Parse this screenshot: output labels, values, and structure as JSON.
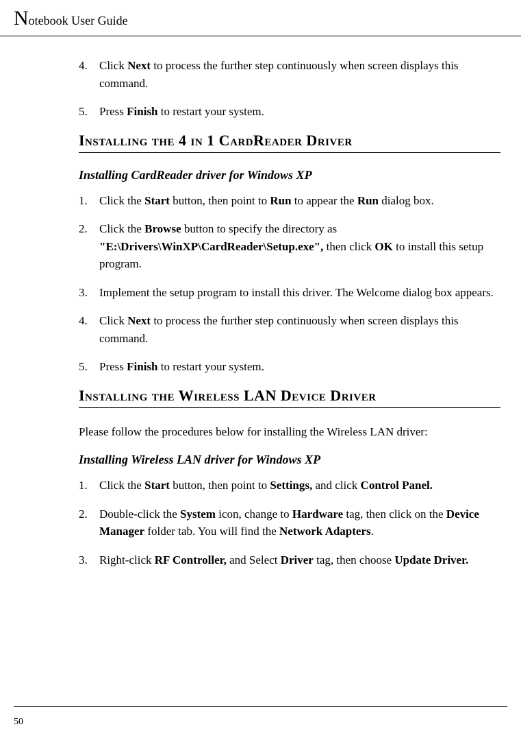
{
  "header": {
    "title_rest": "otebook User Guide"
  },
  "list1": [
    {
      "num": "4.",
      "prefix": "Click ",
      "bold1": "Next",
      "rest": " to process the further step continuously when screen displays this command."
    },
    {
      "num": "5.",
      "prefix": "Press ",
      "bold1": "Finish",
      "rest": " to restart your system."
    }
  ],
  "heading1": "Installing the 4 in 1 CardReader Driver",
  "subheading1": "Installing CardReader driver for Windows XP",
  "list2": {
    "item1": {
      "num": "1.",
      "p1": "Click the ",
      "b1": "Start",
      "p2": " button, then point to ",
      "b2": "Run",
      "p3": " to appear the ",
      "b3": "Run",
      "p4": " dialog box."
    },
    "item2": {
      "num": "2.",
      "p1": "Click the ",
      "b1": "Browse",
      "p2": " button to specify the directory as ",
      "b2": "\"E:\\Drivers\\WinXP\\CardReader\\Setup.exe\",",
      "p3": " then click ",
      "b3": "OK",
      "p4": " to install this setup program."
    },
    "item3": {
      "num": "3.",
      "text": "Implement the setup program to install this driver. The Welcome dialog box appears."
    },
    "item4": {
      "num": "4.",
      "p1": "Click ",
      "b1": "Next",
      "p2": " to process the further step continuously when screen displays this command."
    },
    "item5": {
      "num": "5.",
      "p1": "Press ",
      "b1": "Finish",
      "p2": " to restart your system."
    }
  },
  "heading2": "Installing the Wireless LAN Device Driver",
  "para1": "Please follow the procedures below for installing the Wireless LAN driver:",
  "subheading2": "Installing Wireless LAN driver for Windows XP",
  "list3": {
    "item1": {
      "num": "1.",
      "p1": "Click the ",
      "b1": "Start",
      "p2": " button, then point to ",
      "b2": "Settings,",
      "p3": " and click ",
      "b3": "Control Panel."
    },
    "item2": {
      "num": "2.",
      "p1": "Double-click the ",
      "b1": "System",
      "p2": " icon, change to ",
      "b2": "Hardware",
      "p3": " tag, then click on the ",
      "b3": "Device Manager",
      "p4": " folder tab. You will find the ",
      "b4": "Network Adapters",
      "p5": "."
    },
    "item3": {
      "num": "3.",
      "p1": "Right-click ",
      "b1": "RF Controller,",
      "p2": " and Select ",
      "b2": "Driver",
      "p3": " tag, then choose ",
      "b3": "Update Driver."
    }
  },
  "pagenum": "50"
}
